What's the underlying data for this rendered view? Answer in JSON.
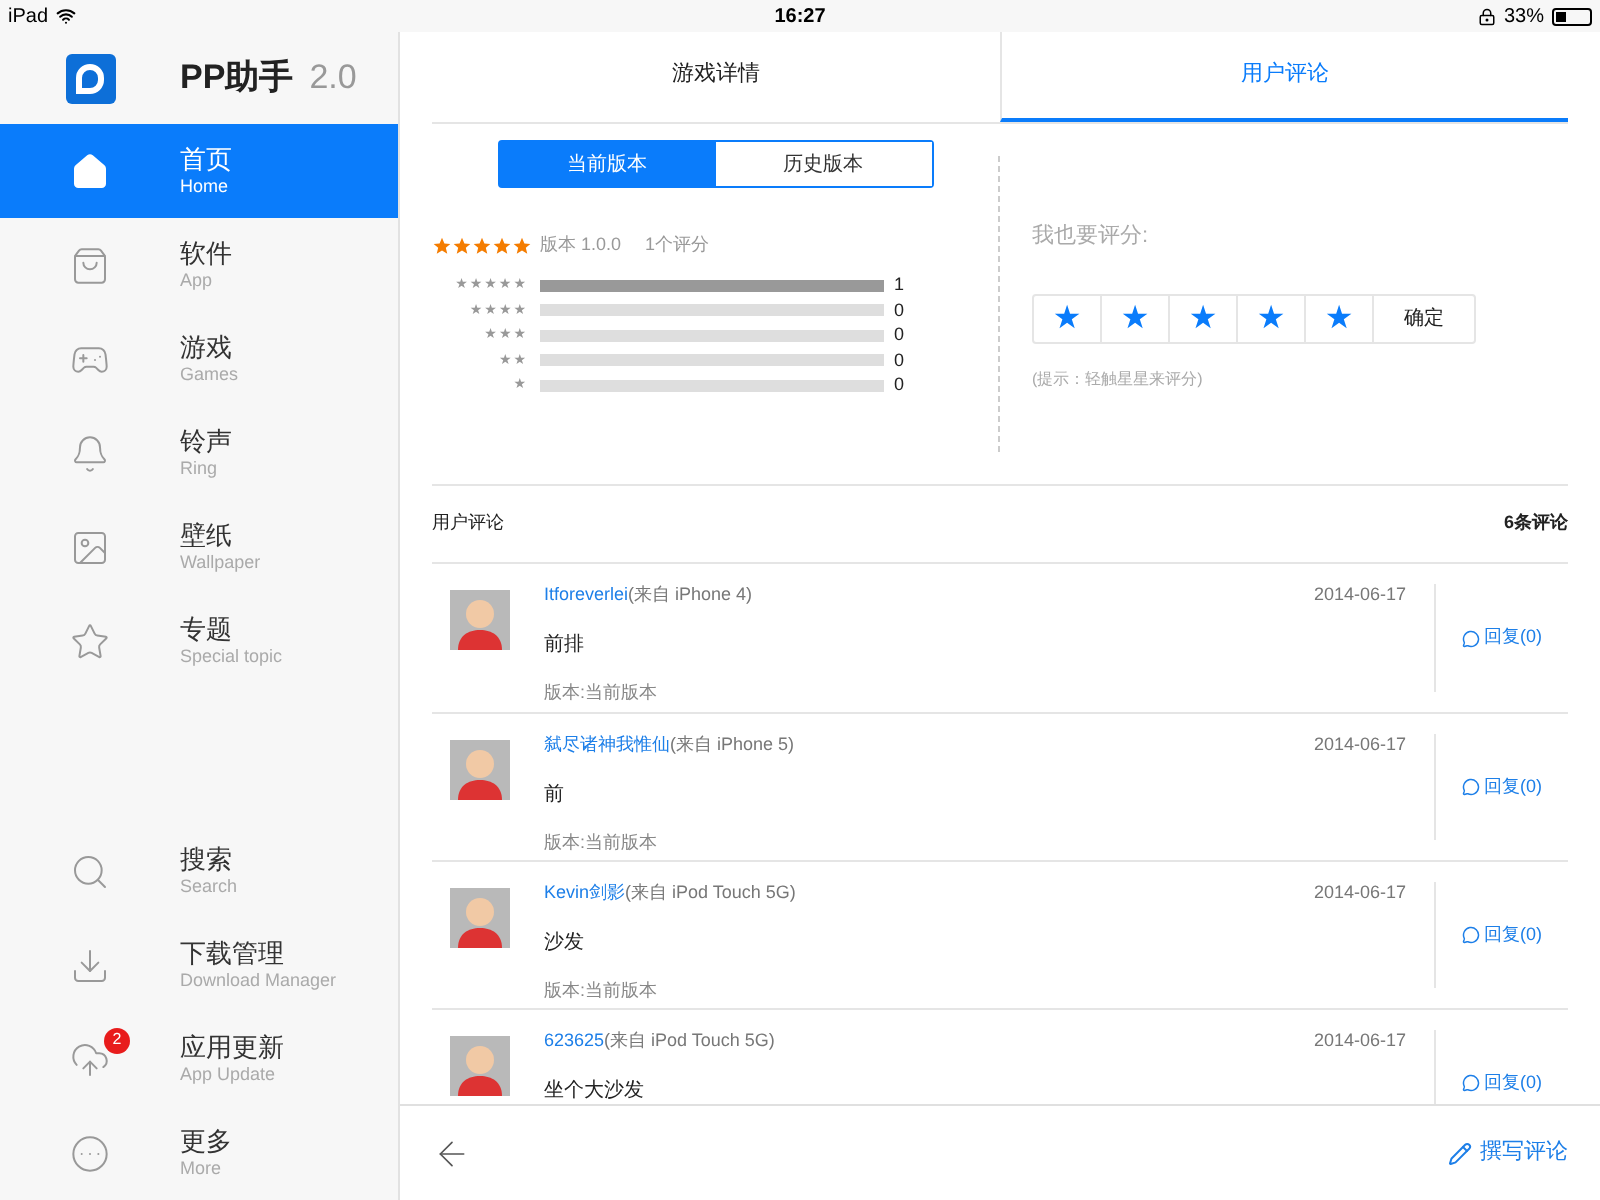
{
  "status_bar": {
    "device": "iPad",
    "time": "16:27",
    "battery": "33%"
  },
  "app": {
    "name": "PP助手",
    "version": "2.0"
  },
  "nav": {
    "main": [
      {
        "label": "首页",
        "sub": "Home",
        "selected": true
      },
      {
        "label": "软件",
        "sub": "App",
        "selected": false
      },
      {
        "label": "游戏",
        "sub": "Games",
        "selected": false
      },
      {
        "label": "铃声",
        "sub": "Ring",
        "selected": false
      },
      {
        "label": "壁纸",
        "sub": "Wallpaper",
        "selected": false
      },
      {
        "label": "专题",
        "sub": "Special topic",
        "selected": false
      }
    ],
    "bottom": [
      {
        "label": "搜索",
        "sub": "Search",
        "selected": false
      },
      {
        "label": "下载管理",
        "sub": "Download Manager",
        "selected": false
      },
      {
        "label": "应用更新",
        "sub": "App Update",
        "selected": false,
        "badge": "2"
      },
      {
        "label": "更多",
        "sub": "More",
        "selected": false
      }
    ]
  },
  "tabs": [
    {
      "label": "游戏详情",
      "selected": false
    },
    {
      "label": "用户评论",
      "selected": true
    }
  ],
  "version_switch": [
    {
      "label": "当前版本",
      "selected": true
    },
    {
      "label": "历史版本",
      "selected": false
    }
  ],
  "rating_summary": {
    "stars": 5,
    "version": "版本 1.0.0",
    "count": "1个评分",
    "rows": [
      {
        "label": "★★★★★",
        "level": 1,
        "count": "1"
      },
      {
        "label": "★★★★",
        "level": 0,
        "count": "0"
      },
      {
        "label": "★★★",
        "level": 0,
        "count": "0"
      },
      {
        "label": "★★",
        "level": 0,
        "count": "0"
      },
      {
        "label": "★",
        "level": 0,
        "count": "0"
      }
    ]
  },
  "my_rating": {
    "label": "我也要评分:",
    "star_buttons": [
      "★",
      "★",
      "★",
      "★",
      "★"
    ],
    "confirm": "确定",
    "hint": "(提示：轻触星星来评分)"
  },
  "comments_header": {
    "title": "用户评论",
    "count": "6条评论"
  },
  "comments": [
    {
      "user": "Itforeverlei",
      "device": "(来自 iPhone 4)",
      "date": "2014-06-17",
      "text": "前排",
      "version": "版本:当前版本",
      "reply": "回复(0)"
    },
    {
      "user": "弑尽诸神我惟仙",
      "device": "(来自 iPhone 5)",
      "date": "2014-06-17",
      "text": "前",
      "version": "版本:当前版本",
      "reply": "回复(0)"
    },
    {
      "user": "Kevin剑影",
      "device": "(来自 iPod Touch 5G)",
      "date": "2014-06-17",
      "text": "沙发",
      "version": "版本:当前版本",
      "reply": "回复(0)"
    },
    {
      "user": "623625",
      "device": "(来自 iPod Touch 5G)",
      "date": "2014-06-17",
      "text": "坐个大沙发",
      "reply": "回复(0)"
    }
  ],
  "footer": {
    "write": "撰写评论"
  }
}
